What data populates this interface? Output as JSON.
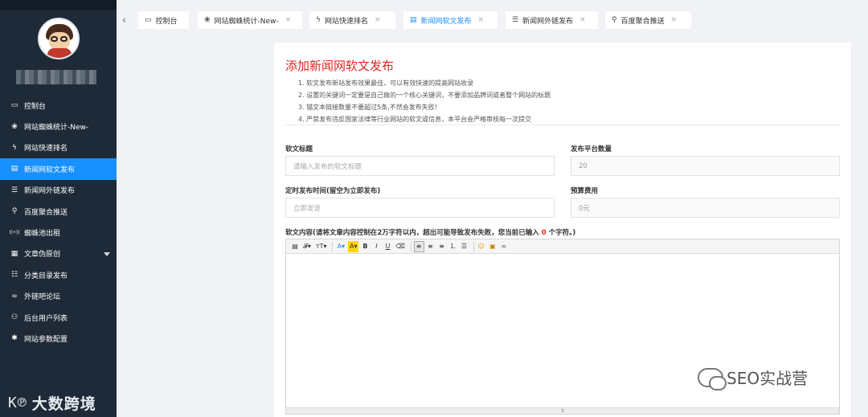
{
  "sidebar": {
    "items": [
      {
        "label": "控制台",
        "icon": "monitor-icon",
        "glyph": "▭"
      },
      {
        "label": "网站蜘蛛统计-New-",
        "icon": "spider-icon",
        "glyph": "❀"
      },
      {
        "label": "网站快速排名",
        "icon": "lightning-icon",
        "glyph": "ϟ"
      },
      {
        "label": "新闻网软文发布",
        "icon": "article-icon",
        "glyph": "▤",
        "active": true
      },
      {
        "label": "新闻网外链发布",
        "icon": "list-icon",
        "glyph": "☰"
      },
      {
        "label": "百度聚合推送",
        "icon": "search-icon",
        "glyph": "⚲"
      },
      {
        "label": "蜘蛛池出租",
        "icon": "broadcast-icon",
        "glyph": "((•))"
      },
      {
        "label": "文章伪原创",
        "icon": "document-icon",
        "glyph": "▦",
        "has_caret": true
      },
      {
        "label": "分类目录发布",
        "icon": "category-icon",
        "glyph": "☷"
      },
      {
        "label": "外链吧论坛",
        "icon": "link-icon",
        "glyph": "∞"
      },
      {
        "label": "后台用户列表",
        "icon": "user-icon",
        "glyph": "⚇"
      },
      {
        "label": "网站参数配置",
        "icon": "settings-icon",
        "glyph": "✱"
      }
    ],
    "watermark": "大数跨境",
    "watermark_icon": "k100"
  },
  "tabs": [
    {
      "label": "控制台",
      "icon": "monitor-icon",
      "glyph": "▭",
      "closable": false
    },
    {
      "label": "网站蜘蛛统计-New-",
      "icon": "spider-icon",
      "glyph": "❀",
      "closable": true
    },
    {
      "label": "网站快速排名",
      "icon": "lightning-icon",
      "glyph": "ϟ",
      "closable": true
    },
    {
      "label": "新闻网软文发布",
      "icon": "article-icon",
      "glyph": "▤",
      "closable": true,
      "active": true
    },
    {
      "label": "新闻网外链发布",
      "icon": "list-icon",
      "glyph": "☰",
      "closable": true
    },
    {
      "label": "百度聚合推送",
      "icon": "search-icon",
      "glyph": "⚲",
      "closable": true
    }
  ],
  "main": {
    "title": "添加新闻网软文发布",
    "notes": [
      "1. 软文发布新站发布效果最佳，可以有效快速的提高网站收录",
      "2. 设置的关键词一定要是自己做的一个核心关键词，不要添加品牌词或者整个网站的标题",
      "3. 锚文本链接数量不要超过5条,不然会发布失败!",
      "4. 严禁发布违反国家法律等行业网站的软文或信息，本平台会严格审核每一次提交"
    ],
    "fields": {
      "title_label": "软文标题",
      "title_placeholder": "请输入发布的软文标题",
      "platform_count_label": "发布平台数量",
      "platform_count_value": "20",
      "schedule_label": "定时发布时间(留空为立即发布)",
      "schedule_placeholder": "立即发送",
      "budget_label": "预算费用",
      "budget_value": "0元",
      "content_label_prefix": "软文内容(请将文章内容控制在2万字符以内，超出可能导致发布失败，您当前已输入 ",
      "content_count": "0",
      "content_label_suffix": " 个字符。)"
    },
    "toolbar": [
      {
        "name": "source-icon",
        "glyph": "▤"
      },
      {
        "name": "font-family-icon",
        "glyph": "𝓕▾"
      },
      {
        "name": "font-size-icon",
        "glyph": "тT▾"
      },
      {
        "sep": true
      },
      {
        "name": "font-color-icon",
        "glyph": "A▾",
        "color": "#1890ff"
      },
      {
        "name": "highlight-icon",
        "glyph": "A▾",
        "bg": "#ffd700"
      },
      {
        "name": "bold-icon",
        "glyph": "B",
        "weight": "bold"
      },
      {
        "name": "italic-icon",
        "glyph": "I",
        "style": "italic"
      },
      {
        "name": "underline-icon",
        "glyph": "U",
        "underline": true
      },
      {
        "name": "eraser-icon",
        "glyph": "⌫"
      },
      {
        "sep": true
      },
      {
        "name": "align-left-icon",
        "glyph": "≡",
        "on": true
      },
      {
        "name": "align-center-icon",
        "glyph": "≡"
      },
      {
        "name": "align-right-icon",
        "glyph": "≡"
      },
      {
        "name": "ordered-list-icon",
        "glyph": "⒈"
      },
      {
        "name": "unordered-list-icon",
        "glyph": "☰"
      },
      {
        "sep": true
      },
      {
        "name": "emoji-icon",
        "glyph": "☺",
        "color": "#e6a100"
      },
      {
        "name": "image-icon",
        "glyph": "▣",
        "color": "#c47f00"
      },
      {
        "name": "link-icon",
        "glyph": "∞",
        "color": "#555"
      }
    ],
    "resize_glyph": "⇕"
  },
  "watermark_right": "SEO实战营"
}
